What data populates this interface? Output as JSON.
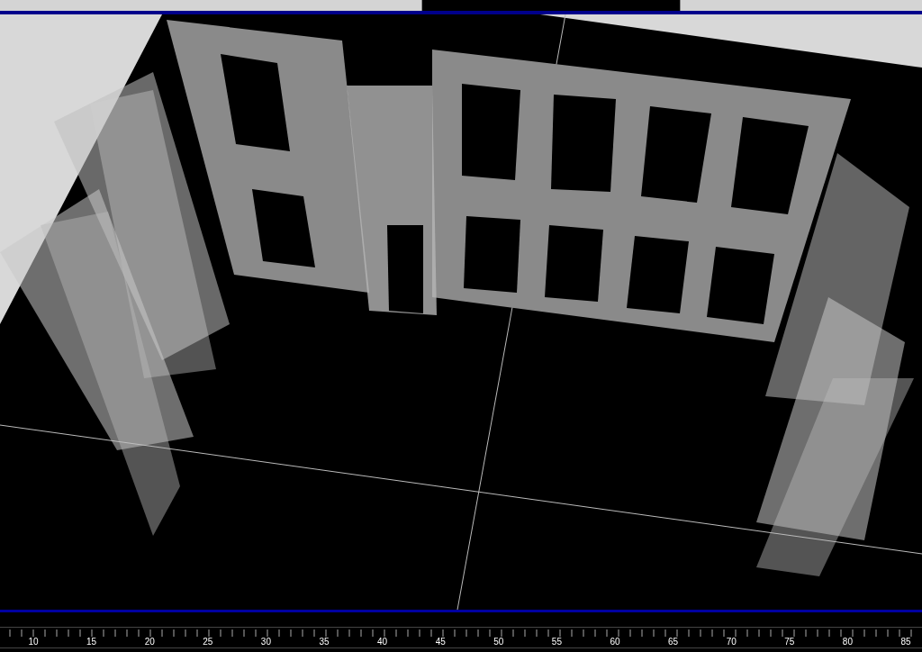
{
  "timeline": {
    "labels": [
      "10",
      "15",
      "20",
      "25",
      "30",
      "35",
      "40",
      "45",
      "50",
      "55",
      "60",
      "65",
      "70",
      "75",
      "80",
      "85"
    ]
  }
}
